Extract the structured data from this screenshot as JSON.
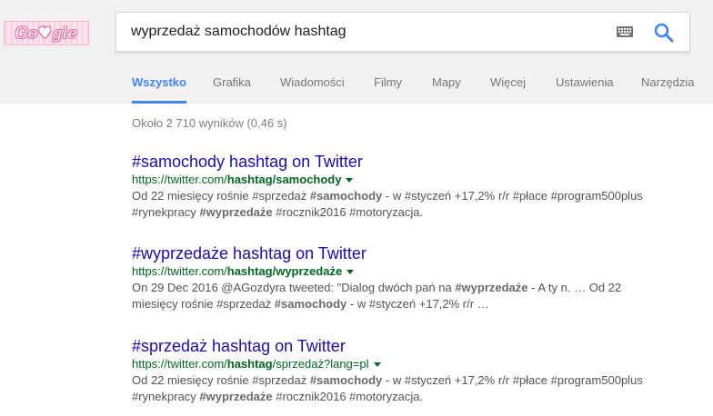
{
  "logo": {
    "text": "Go♥gle",
    "color": "#e86e9f"
  },
  "search": {
    "query": "wyprzedaż samochodów hashtag",
    "keyboard_icon": "keyboard-icon",
    "search_icon": "magnifier-icon",
    "accent": "#4285f4"
  },
  "tabs": [
    {
      "label": "Wszystko",
      "active": true
    },
    {
      "label": "Grafika"
    },
    {
      "label": "Wiadomości"
    },
    {
      "label": "Filmy"
    },
    {
      "label": "Mapy"
    },
    {
      "label": "Więcej"
    },
    {
      "label": "Ustawienia"
    },
    {
      "label": "Narzędzia"
    }
  ],
  "stats": "Około 2 710 wyników (0,46 s)",
  "results": [
    {
      "title": "#samochody hashtag on Twitter",
      "url_prefix": "https://twitter.com/",
      "url_bold": "hashtag/samochody",
      "url_suffix": "",
      "snippet_1": "Od 22 miesięcy rośnie #sprzedaż ",
      "snippet_1_bold": "#samochody",
      "snippet_2": " - w #styczeń +17,2% r/r #płace #program500plus",
      "snippet_3": "#rynekpracy ",
      "snippet_3_bold": "#wyprzedaże",
      "snippet_4": " #rocznik2016 #motoryzacja."
    },
    {
      "title": "#wyprzedaże hashtag on Twitter",
      "url_prefix": "https://twitter.com/",
      "url_bold": "hashtag/wyprzedaże",
      "url_suffix": "",
      "snippet_1": "On 29 Dec 2016 @AGozdyra tweeted: \"Dialog dwóch pań na ",
      "snippet_1_bold": "#wyprzedaże",
      "snippet_2": " - A ty n. … Od 22",
      "snippet_3": "miesięcy rośnie #sprzedaż ",
      "snippet_3_bold": "#samochody",
      "snippet_4": " - w #styczeń +17,2% r/r …"
    },
    {
      "title": "#sprzedaż hashtag on Twitter",
      "url_prefix": "https://twitter.com/",
      "url_bold": "hashtag",
      "url_suffix": "/sprzedaż?lang=pl",
      "snippet_1": "Od 22 miesięcy rośnie #sprzedaż ",
      "snippet_1_bold": "#samochody",
      "snippet_2": " - w #styczeń +17,2% r/r #płace #program500plus",
      "snippet_3": "#rynekpracy ",
      "snippet_3_bold": "#wyprzedaże",
      "snippet_4": " #rocznik2016 #motoryzacja."
    }
  ],
  "colors": {
    "title": "#1a0dab",
    "url": "#006621",
    "snippet": "#545454",
    "tab_active": "#4285f4"
  }
}
